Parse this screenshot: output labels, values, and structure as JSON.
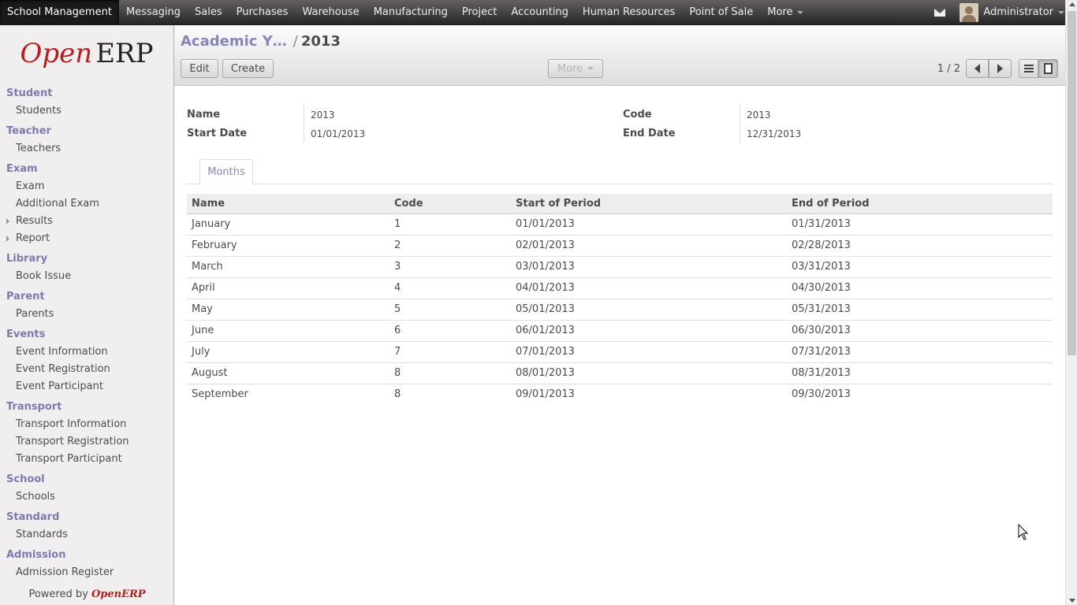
{
  "topbar": {
    "menu": [
      "School Management",
      "Messaging",
      "Sales",
      "Purchases",
      "Warehouse",
      "Manufacturing",
      "Project",
      "Accounting",
      "Human Resources",
      "Point of Sale",
      "More"
    ],
    "active": "School Management",
    "user": "Administrator"
  },
  "logo": {
    "open": "Open",
    "erp": "ERP"
  },
  "sidebar": {
    "sections": [
      {
        "title": "Student",
        "items": [
          {
            "label": "Students"
          }
        ]
      },
      {
        "title": "Teacher",
        "items": [
          {
            "label": "Teachers"
          }
        ]
      },
      {
        "title": "Exam",
        "items": [
          {
            "label": "Exam"
          },
          {
            "label": "Additional Exam"
          },
          {
            "label": "Results",
            "expandable": true
          },
          {
            "label": "Report",
            "expandable": true
          }
        ]
      },
      {
        "title": "Library",
        "items": [
          {
            "label": "Book Issue"
          }
        ]
      },
      {
        "title": "Parent",
        "items": [
          {
            "label": "Parents"
          }
        ]
      },
      {
        "title": "Events",
        "items": [
          {
            "label": "Event Information"
          },
          {
            "label": "Event Registration"
          },
          {
            "label": "Event Participant"
          }
        ]
      },
      {
        "title": "Transport",
        "items": [
          {
            "label": "Transport Information"
          },
          {
            "label": "Transport Registration"
          },
          {
            "label": "Transport Participant"
          }
        ]
      },
      {
        "title": "School",
        "items": [
          {
            "label": "Schools"
          }
        ]
      },
      {
        "title": "Standard",
        "items": [
          {
            "label": "Standards"
          }
        ]
      },
      {
        "title": "Admission",
        "items": [
          {
            "label": "Admission Register"
          }
        ]
      }
    ],
    "powered_prefix": "Powered by",
    "powered_brand": "OpenERP"
  },
  "header": {
    "breadcrumb_parent": "Academic Y…",
    "breadcrumb_sep": "/",
    "breadcrumb_current": "2013",
    "edit_label": "Edit",
    "create_label": "Create",
    "more_label": "More",
    "pager": "1 / 2"
  },
  "form": {
    "name_label": "Name",
    "name_value": "2013",
    "code_label": "Code",
    "code_value": "2013",
    "start_label": "Start Date",
    "start_value": "01/01/2013",
    "end_label": "End Date",
    "end_value": "12/31/2013"
  },
  "tabs": {
    "months": "Months"
  },
  "months_table": {
    "columns": [
      "Name",
      "Code",
      "Start of Period",
      "End of Period"
    ],
    "rows": [
      [
        "January",
        "1",
        "01/01/2013",
        "01/31/2013"
      ],
      [
        "February",
        "2",
        "02/01/2013",
        "02/28/2013"
      ],
      [
        "March",
        "3",
        "03/01/2013",
        "03/31/2013"
      ],
      [
        "April",
        "4",
        "04/01/2013",
        "04/30/2013"
      ],
      [
        "May",
        "5",
        "05/01/2013",
        "05/31/2013"
      ],
      [
        "June",
        "6",
        "06/01/2013",
        "06/30/2013"
      ],
      [
        "July",
        "7",
        "07/01/2013",
        "07/31/2013"
      ],
      [
        "August",
        "8",
        "08/01/2013",
        "08/31/2013"
      ],
      [
        "September",
        "8",
        "09/01/2013",
        "09/30/2013"
      ]
    ]
  },
  "colors": {
    "accent": "#7c7bad",
    "brand_red": "#b91d1d",
    "topbar": "#262626"
  },
  "icons": {
    "mail": "mail-icon",
    "prev": "arrow-left-icon",
    "next": "arrow-right-icon",
    "list_view": "list-view-icon",
    "form_view": "form-view-icon"
  }
}
